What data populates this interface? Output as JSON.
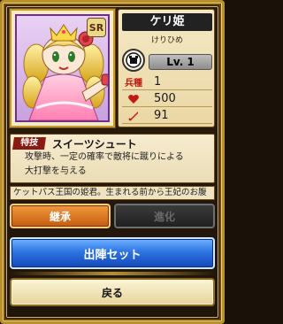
{
  "card": {
    "rarity": "SR",
    "name": "ケリ姫",
    "reading": "けりひめ",
    "level": "Lv. 1",
    "stats": [
      {
        "icon": "兵種",
        "value": "1"
      },
      {
        "icon": "heart-icon",
        "value": "500"
      },
      {
        "icon": "sword-icon",
        "value": "91"
      }
    ]
  },
  "skill": {
    "tag": "特技",
    "name": "スイーツシュート",
    "description_lines": [
      "攻撃時、一定の確率で敵将に蹴りによる",
      "大打撃を与える"
    ]
  },
  "profile_text": "ケットパス王国の姫君。生まれる前から王妃のお腹",
  "buttons": {
    "inherit": "継承",
    "evolve": "進化",
    "sortie": "出陣セット",
    "back": "戻る"
  },
  "colors": {
    "accent_gold": "#b8902e",
    "sortie_blue": "#2d74e3",
    "inherit_orange": "#e07a1f",
    "stat_red": "#c21a10"
  }
}
